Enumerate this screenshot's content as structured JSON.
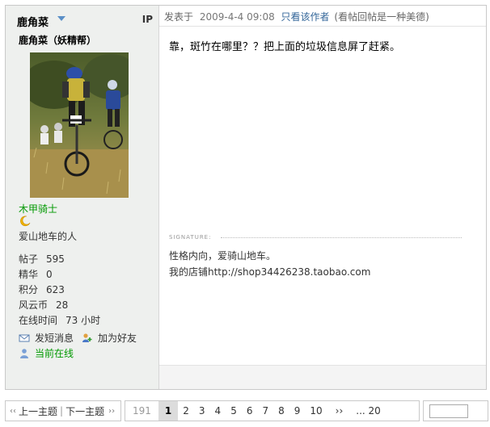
{
  "author": {
    "name": "鹿角菜",
    "ip_label": "IP",
    "nickname": "鹿角菜（妖精帮）",
    "rank": "木甲骑士",
    "bio": "爱山地车的人",
    "stats": [
      {
        "label": "帖子",
        "value": "595"
      },
      {
        "label": "精华",
        "value": "0"
      },
      {
        "label": "积分",
        "value": "623"
      },
      {
        "label": "风云币",
        "value": "28"
      },
      {
        "label": "在线时间",
        "value": "73 小时"
      }
    ],
    "actions": {
      "message": "发短消息",
      "add_friend": "加为好友",
      "online": "当前在线"
    }
  },
  "post": {
    "posted_label": "发表于",
    "time": "2009-4-4 09:08",
    "only_author": "只看该作者",
    "tip": "(看帖回帖是一种美德)",
    "content": "靠，斑竹在哪里？？把上面的垃圾信息屏了赶紧。",
    "signature_label": "SIGNATURE:",
    "signature_lines": [
      "性格内向，爱骑山地车。",
      "我的店铺http://shop34426238.taobao.com"
    ]
  },
  "nav": {
    "prev": "上一主题",
    "separator": "|",
    "next": "下一主题"
  },
  "pager": {
    "first": "191",
    "pages": [
      "1",
      "2",
      "3",
      "4",
      "5",
      "6",
      "7",
      "8",
      "9",
      "10"
    ],
    "current": "1",
    "next": "››",
    "last": "... 20"
  },
  "colors": {
    "sidebar_bg": "#eef0ee",
    "rank_green": "#009900",
    "link_blue": "#336699"
  }
}
